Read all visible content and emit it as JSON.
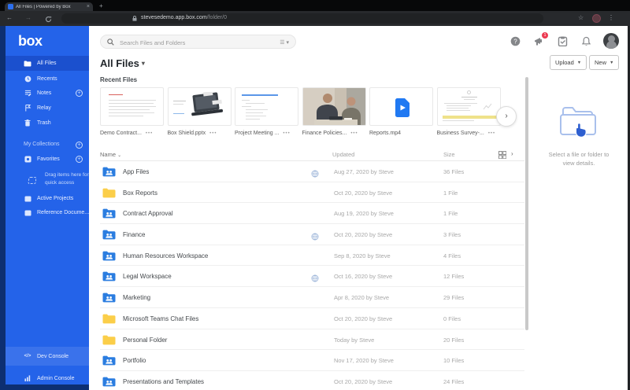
{
  "browser": {
    "tab_title": "All Files | Powered by Box",
    "new_tab": "+",
    "close": "×",
    "url_domain": "stevesedemo.app.box.com",
    "url_path": "/folder/0"
  },
  "sidebar": {
    "logo": "box",
    "items": [
      {
        "label": "All Files"
      },
      {
        "label": "Recents"
      },
      {
        "label": "Notes"
      },
      {
        "label": "Relay"
      },
      {
        "label": "Trash"
      }
    ],
    "collections_header": "My Collections",
    "favorites_label": "Favorites",
    "drag_hint": "Drag items here for quick access",
    "collections": [
      {
        "label": "Active Projects"
      },
      {
        "label": "Reference Docume..."
      }
    ],
    "bottom": [
      {
        "label": "Dev Console"
      },
      {
        "label": "Admin Console"
      }
    ]
  },
  "header": {
    "search_placeholder": "Search Files and Folders",
    "title": "All Files",
    "upload_label": "Upload",
    "new_label": "New",
    "notification_count": "1"
  },
  "recent": {
    "label": "Recent Files",
    "cards": [
      {
        "name": "Demo Contract...",
        "type": "doc-red"
      },
      {
        "name": "Box Shield.pptx",
        "type": "slide"
      },
      {
        "name": "Project Meeting ...",
        "type": "doc-blue"
      },
      {
        "name": "Finance Policies...",
        "type": "photo"
      },
      {
        "name": "Reports.mp4",
        "type": "video"
      },
      {
        "name": "Business Survey-...",
        "type": "doc-highlight"
      }
    ]
  },
  "list": {
    "columns": {
      "name": "Name",
      "updated": "Updated",
      "size": "Size"
    },
    "rows": [
      {
        "name": "App Files",
        "folder": "blue",
        "shared": true,
        "updated": "Aug 27, 2020 by Steve",
        "size": "36 Files"
      },
      {
        "name": "Box Reports",
        "folder": "yellow",
        "shared": false,
        "updated": "Oct 20, 2020 by Steve",
        "size": "1 File"
      },
      {
        "name": "Contract Approval",
        "folder": "blue",
        "shared": false,
        "updated": "Aug 19, 2020 by Steve",
        "size": "1 File"
      },
      {
        "name": "Finance",
        "folder": "blue",
        "shared": true,
        "updated": "Oct 20, 2020 by Steve",
        "size": "3 Files"
      },
      {
        "name": "Human Resources Workspace",
        "folder": "blue",
        "shared": false,
        "updated": "Sep 8, 2020 by Steve",
        "size": "4 Files"
      },
      {
        "name": "Legal Workspace",
        "folder": "blue",
        "shared": true,
        "updated": "Oct 16, 2020 by Steve",
        "size": "12 Files"
      },
      {
        "name": "Marketing",
        "folder": "blue",
        "shared": false,
        "updated": "Apr 8, 2020 by Steve",
        "size": "29 Files"
      },
      {
        "name": "Microsoft Teams Chat Files",
        "folder": "yellow",
        "shared": false,
        "updated": "Oct 20, 2020 by Steve",
        "size": "0 Files"
      },
      {
        "name": "Personal Folder",
        "folder": "yellow",
        "shared": false,
        "updated": "Today by Steve",
        "size": "20 Files"
      },
      {
        "name": "Portfolio",
        "folder": "blue",
        "shared": false,
        "updated": "Nov 17, 2020 by Steve",
        "size": "10 Files"
      },
      {
        "name": "Presentations and Templates",
        "folder": "blue",
        "shared": false,
        "updated": "Oct 20, 2020 by Steve",
        "size": "24 Files"
      }
    ]
  },
  "details": {
    "message_line1": "Select a file or folder to",
    "message_line2": "view details."
  },
  "colors": {
    "sidebar": "#2463e9",
    "sidebar_selected": "#1b50ce",
    "rail": "#0d2f72",
    "folder_blue": "#2b7de0",
    "folder_yellow": "#fccf4a",
    "accent_blue": "#2c6fed",
    "badge_red": "#ec3a50"
  }
}
